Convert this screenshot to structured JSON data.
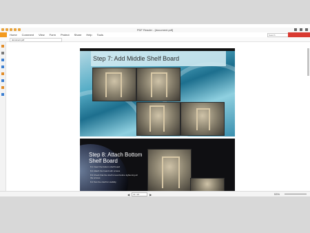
{
  "window": {
    "title": "PDF Reader - [document.pdf]"
  },
  "ribbon": {
    "menu": [
      "Home",
      "Comment",
      "View",
      "Form",
      "Protect",
      "Share",
      "Help",
      "Tools"
    ],
    "search_placeholder": "Search",
    "document_tab": "document.pdf"
  },
  "slide1": {
    "title": "Step 7: Add Middle Shelf Board"
  },
  "slide2": {
    "title": "Step 8: Attach Bottom Shelf Board",
    "bullets": [
      "8.1 Insert the bottom shelf board",
      "8.2 Attach the board with screws",
      "8.3 Check that the shelf is level before tightening all the screws",
      "8.4 Test the shelf for stability"
    ]
  },
  "status": {
    "page": "11 / 24",
    "zoom": "53%"
  },
  "colors": {
    "accent": "#f39a1e",
    "brand_red": "#d93a31",
    "slide_teal": "#58aec7"
  }
}
